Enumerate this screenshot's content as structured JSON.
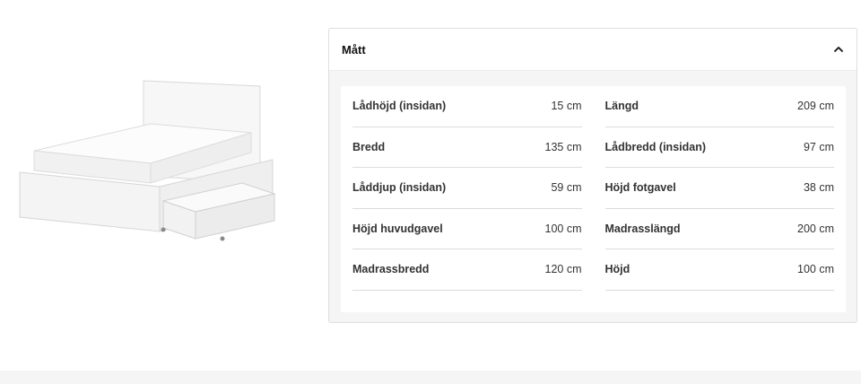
{
  "panel": {
    "title": "Mått",
    "chevron_icon": "chevron-up-icon"
  },
  "dimensions": {
    "left": [
      {
        "label": "Lådhöjd (insidan)",
        "value": "15 cm"
      },
      {
        "label": "Bredd",
        "value": "135 cm"
      },
      {
        "label": "Låddjup (insidan)",
        "value": "59 cm"
      },
      {
        "label": "Höjd huvudgavel",
        "value": "100 cm"
      },
      {
        "label": "Madrassbredd",
        "value": "120 cm"
      }
    ],
    "right": [
      {
        "label": "Längd",
        "value": "209 cm"
      },
      {
        "label": "Lådbredd (insidan)",
        "value": "97 cm"
      },
      {
        "label": "Höjd fotgavel",
        "value": "38 cm"
      },
      {
        "label": "Madrasslängd",
        "value": "200 cm"
      },
      {
        "label": "Höjd",
        "value": "100 cm"
      }
    ]
  },
  "colors": {
    "panel_bg": "#f5f5f5",
    "divider": "#dcdcdc",
    "text": "#333333"
  }
}
